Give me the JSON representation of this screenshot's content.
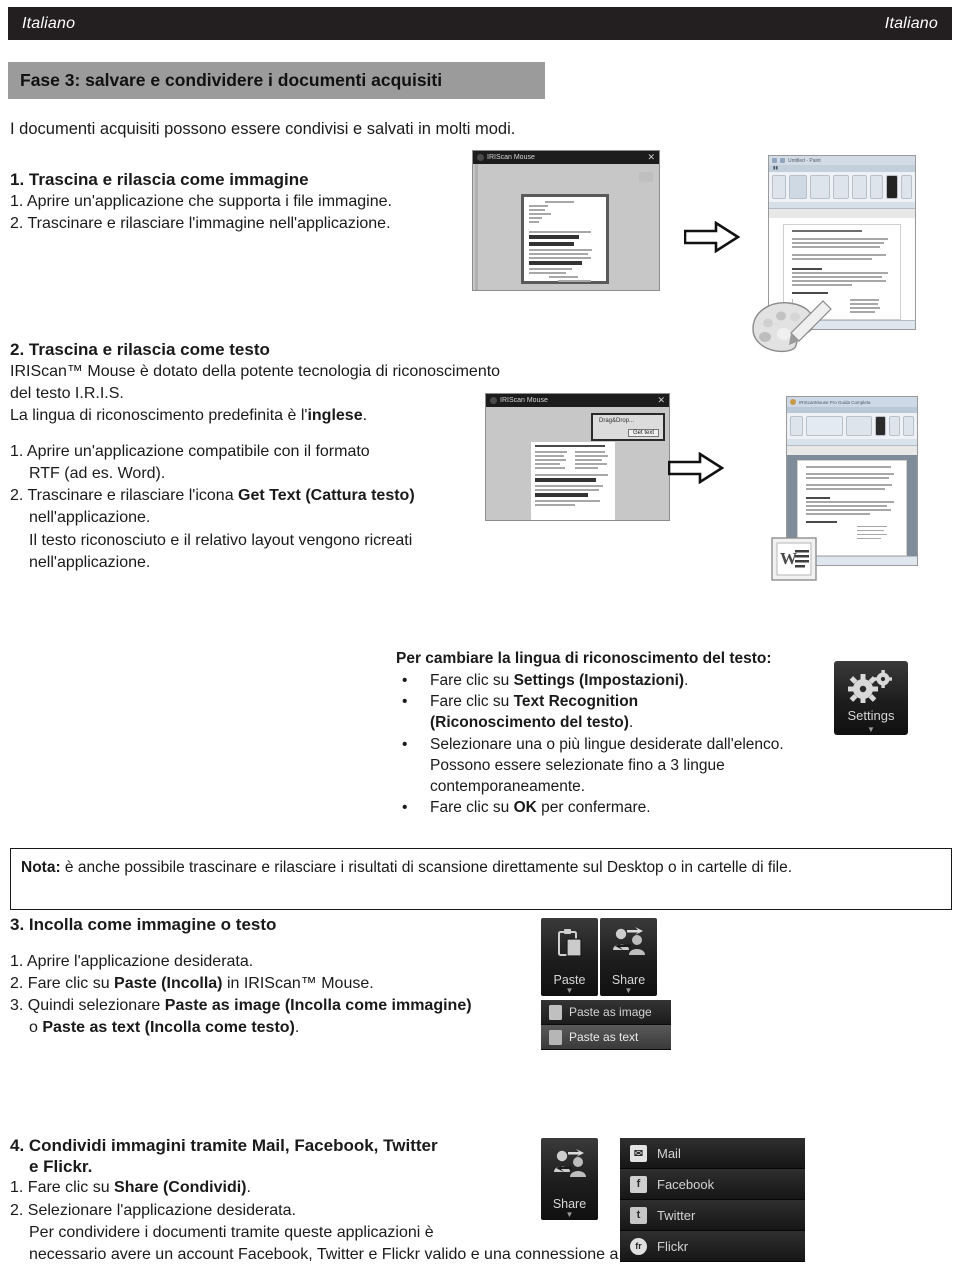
{
  "header": {
    "left_label": "Italiano",
    "right_label": "Italiano"
  },
  "title": {
    "text": "Fase 3: salvare e condividere i documenti acquisiti"
  },
  "intro": {
    "text": "I documenti acquisiti possono essere condivisi e salvati in molti modi."
  },
  "section1": {
    "heading": "1. Trascina e rilascia come immagine",
    "steps": [
      "1. Aprire un'applicazione che supporta i file immagine.",
      "2. Trascinare e rilasciare l'immagine nell'applicazione."
    ]
  },
  "section2": {
    "heading": "2. Trascina e rilascia come testo",
    "line1": "IRIScan™ Mouse è dotato della potente tecnologia di riconoscimento del testo I.R.I.S.",
    "line2_pre": "La lingua di riconoscimento predefinita è l'",
    "line2_bold": "inglese",
    "line2_post": ".",
    "step1": "1. Aprire un'applicazione compatibile con il formato",
    "step1b": "RTF (ad es. Word).",
    "step2_pre": "2. Trascinare e rilasciare l'icona ",
    "step2_bold": "Get Text (Cattura testo)",
    "step2b": "nell'applicazione.",
    "step2c": "Il testo riconosciuto e il relativo layout vengono ricreati",
    "step2d": "nell'applicazione."
  },
  "tips": {
    "heading": "Per cambiare la lingua di riconoscimento del testo:",
    "items": [
      {
        "pre": "Fare clic su ",
        "bold": "Settings (Impostazioni)",
        "post": "."
      },
      {
        "pre": "Fare clic su ",
        "bold": "Text Recognition",
        "post": ""
      },
      {
        "pre": "",
        "bold": "(Riconoscimento del testo)",
        "post": "."
      },
      {
        "pre": "Selezionare una o più lingue desiderate dall'elenco.",
        "bold": "",
        "post": ""
      },
      {
        "pre": "Possono essere selezionate fino a 3 lingue",
        "bold": "",
        "post": ""
      },
      {
        "pre": "contemporaneamente.",
        "bold": "",
        "post": ""
      },
      {
        "pre": "Fare clic su ",
        "bold": "OK",
        "post": " per confermare."
      }
    ]
  },
  "note": {
    "label": "Nota:",
    "text": " è anche possibile trascinare e rilasciare i risultati di scansione direttamente sul Desktop o in cartelle di file."
  },
  "section3": {
    "heading": "3. Incolla come immagine o testo",
    "step1": "1. Aprire l'applicazione desiderata.",
    "step2_pre": "2. Fare clic su ",
    "step2_bold": "Paste (Incolla)",
    "step2_post": " in IRIScan™ Mouse.",
    "step3_pre": "3. Quindi selezionare ",
    "step3_bold": "Paste as image (Incolla come immagine)",
    "step3b_pre": "o ",
    "step3b_bold": "Paste as text (Incolla come testo)",
    "step3b_post": "."
  },
  "section4": {
    "heading_line1": "4. Condividi immagini tramite Mail, Facebook, Twitter",
    "heading_line2": "e Flickr.",
    "step1_pre": "1. Fare clic su ",
    "step1_bold": "Share (Condividi)",
    "step1_post": ".",
    "step2": "2. Selezionare l'applicazione desiderata.",
    "step2b": "Per condividere i documenti tramite queste applicazioni è",
    "step2c": "necessario avere un account Facebook, Twitter e Flickr valido e una connessione a internet."
  },
  "app_ui": {
    "iriscan_window_title": "IRIScan Mouse",
    "drag_drop_label": "Drag&Drop...",
    "get_text_label": "Get text",
    "settings_tile_label": "Settings",
    "paste_tile_label": "Paste",
    "share_tile_label": "Share",
    "paste_menu": [
      {
        "label": "Paste as image"
      },
      {
        "label": "Paste as text"
      }
    ],
    "share_menu": [
      {
        "label": "Mail",
        "glyph": "✉"
      },
      {
        "label": "Facebook",
        "glyph": "f"
      },
      {
        "label": "Twitter",
        "glyph": "t"
      },
      {
        "label": "Flickr",
        "glyph": "fr"
      }
    ],
    "paint_window_title": "Untitled - Paint",
    "word_window_title": "IRIScanMouse Pro Guida Completa"
  },
  "colors": {
    "header_bar": "#231f20",
    "title_chip": "#9b9b9b",
    "tile_dark": "#1d1d1d",
    "page_bg": "#ffffff",
    "text": "#1a1a1a"
  }
}
